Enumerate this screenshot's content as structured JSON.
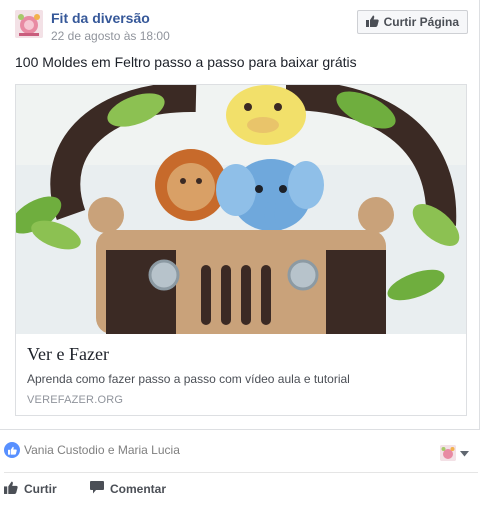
{
  "post": {
    "page_name": "Fit da diversão",
    "timestamp": "22 de agosto às 18:00",
    "like_page_label": "Curtir Página",
    "text": "100 Moldes em Feltro passo a passo para baixar grátis"
  },
  "link": {
    "title": "Ver e Fazer",
    "description": "Aprenda como fazer passo a passo com vídeo aula e tutorial",
    "domain": "VEREFAZER.ORG"
  },
  "reactions": {
    "names": "Vania Custodio e Maria Lucia"
  },
  "actions": {
    "like_label": "Curtir",
    "comment_label": "Comentar"
  },
  "icons": {
    "like": "thumbs-up-icon",
    "comment": "speech-bubble-icon",
    "dropdown": "caret-down-icon"
  },
  "colors": {
    "link_blue": "#365899",
    "reaction_blue": "#5890ff",
    "muted_text": "#90949c"
  }
}
